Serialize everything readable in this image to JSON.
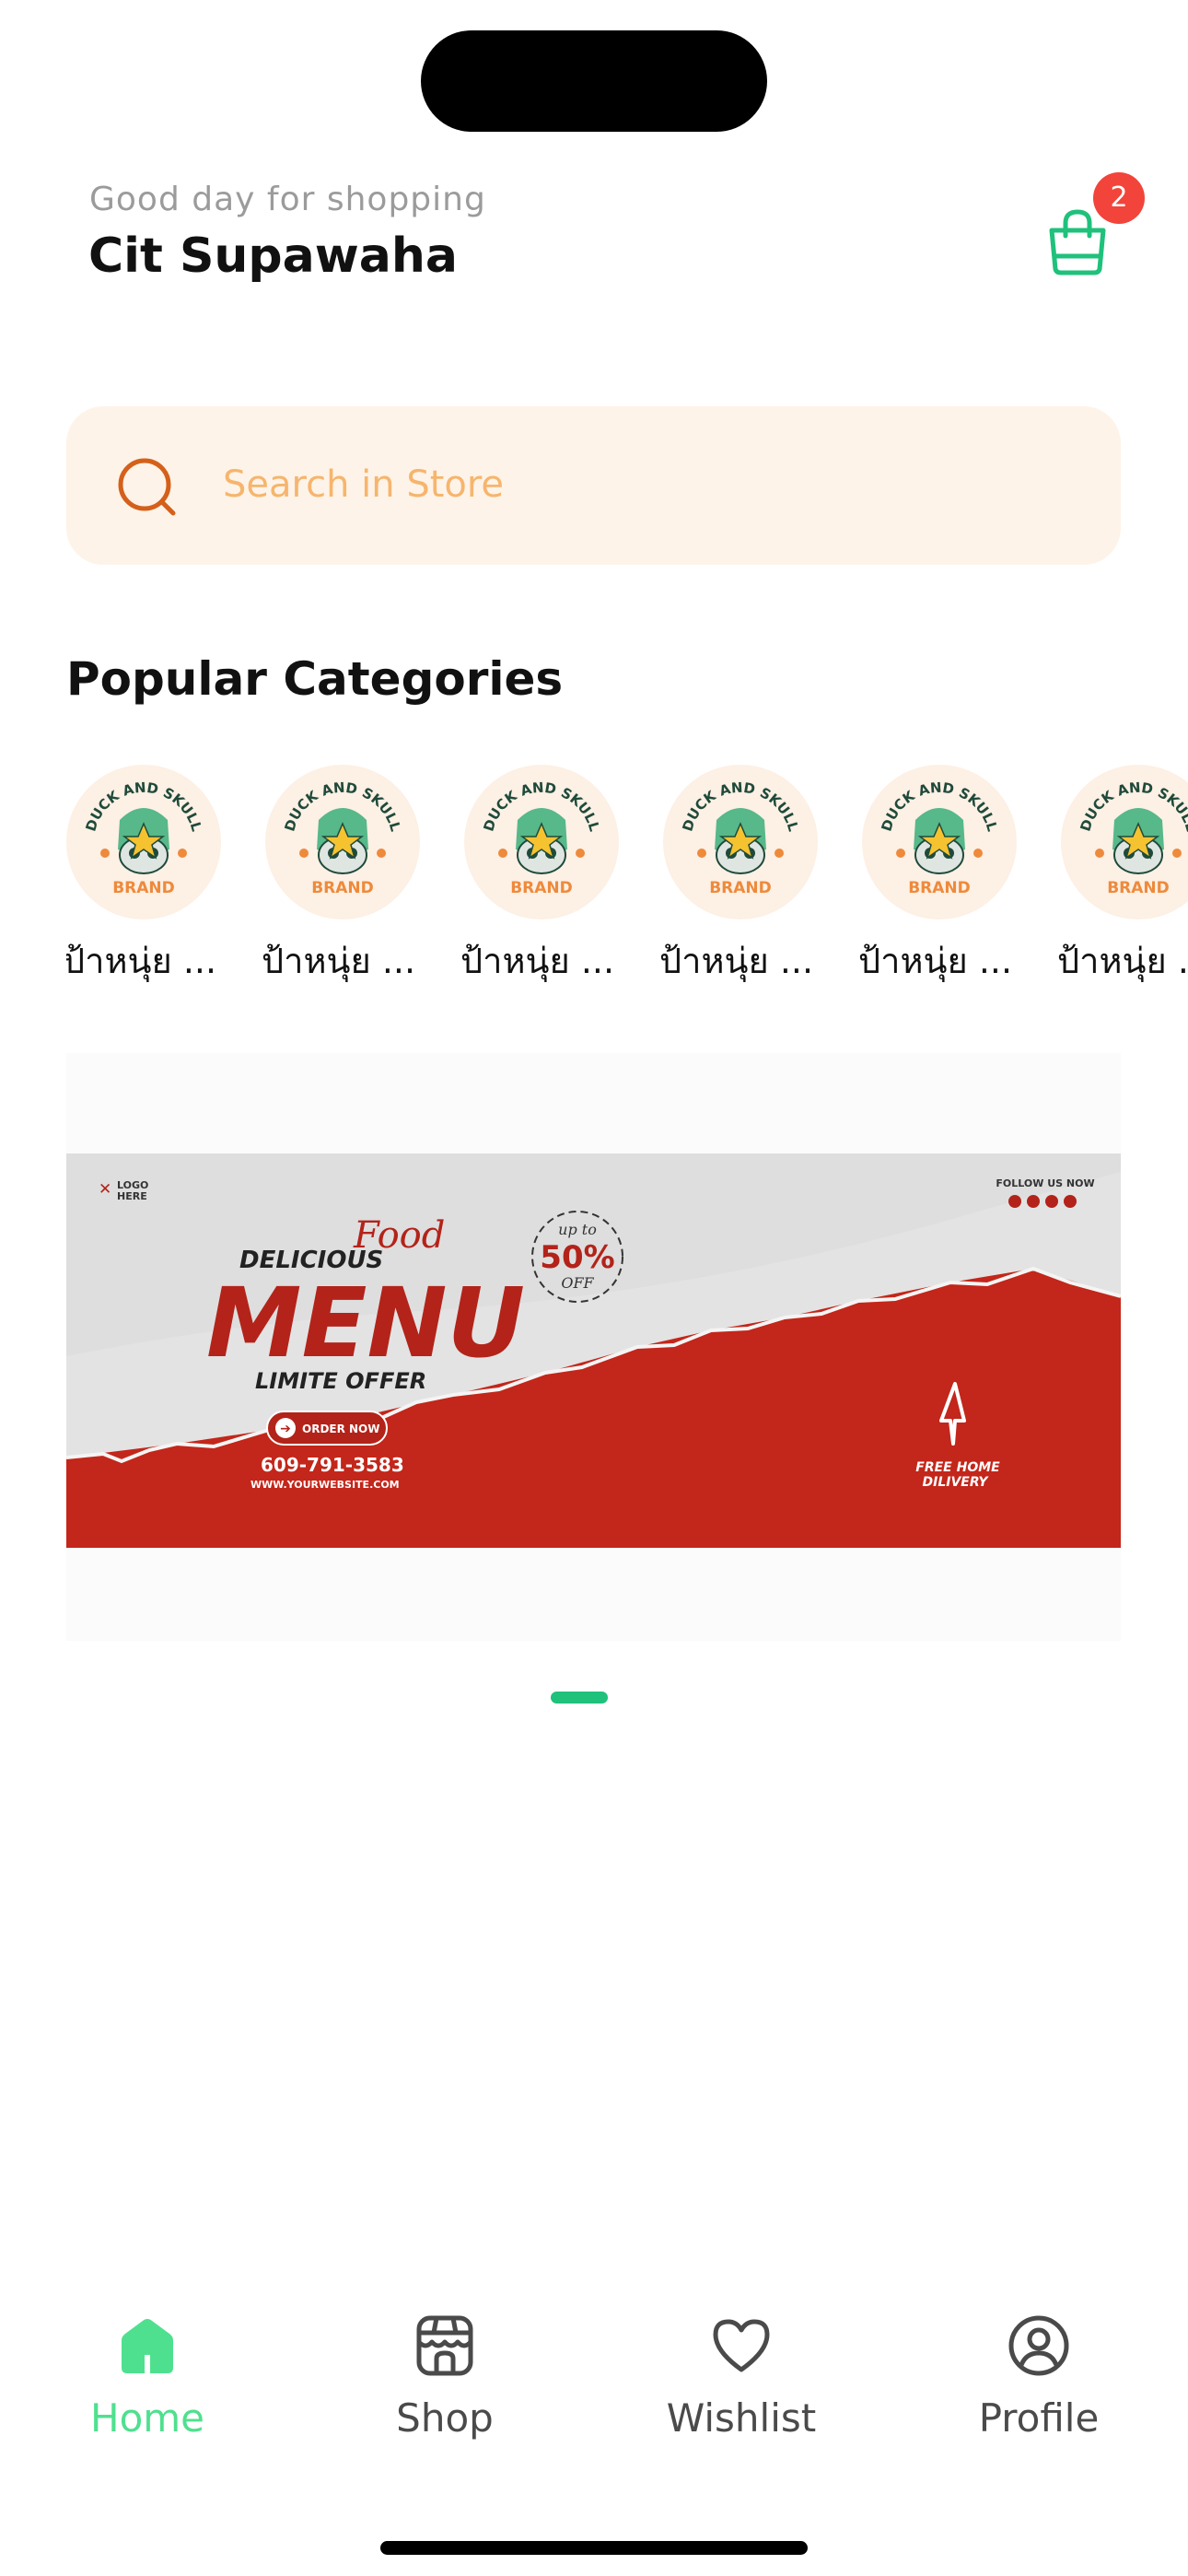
{
  "header": {
    "greeting": "Good day for shopping",
    "user_name": "Cit Supawaha",
    "cart_count": "2"
  },
  "search": {
    "placeholder": "Search in Store"
  },
  "categories": {
    "title": "Popular Categories",
    "items": [
      {
        "label": "ป้าหนุ่ย ..."
      },
      {
        "label": "ป้าหนุ่ย ..."
      },
      {
        "label": "ป้าหนุ่ย ..."
      },
      {
        "label": "ป้าหนุ่ย ..."
      },
      {
        "label": "ป้าหนุ่ย ..."
      },
      {
        "label": "ป้าหนุ่ย ..."
      }
    ],
    "logo_text_top": "DUCK AND SKULL",
    "logo_text_bottom": "BRAND"
  },
  "banner": {
    "logo_line1": "LOGO",
    "logo_line2": "HERE",
    "delicious": "DELICIOUS",
    "food": "Food",
    "menu": "MENU",
    "offer": "LIMITE OFFER",
    "order_now": "ORDER NOW",
    "phone": "609-791-3583",
    "website": "WWW.YOURWEBSITE.COM",
    "upto": "up to",
    "discount": "50%",
    "off": "OFF",
    "follow": "FOLLOW US NOW",
    "free_line1": "FREE HOME",
    "free_line2": "DILIVERY"
  },
  "carousel": {
    "active_index": 0,
    "count": 1
  },
  "nav": {
    "items": [
      {
        "label": "Home",
        "icon": "home-icon",
        "active": true
      },
      {
        "label": "Shop",
        "icon": "shop-icon",
        "active": false
      },
      {
        "label": "Wishlist",
        "icon": "heart-icon",
        "active": false
      },
      {
        "label": "Profile",
        "icon": "profile-icon",
        "active": false
      }
    ]
  },
  "colors": {
    "accent": "#1fc17b",
    "nav_active": "#4fe08f",
    "search_bg": "#fef3e8",
    "search_text": "#f6b56d",
    "badge": "#f2443a",
    "banner_red": "#c3261a"
  }
}
